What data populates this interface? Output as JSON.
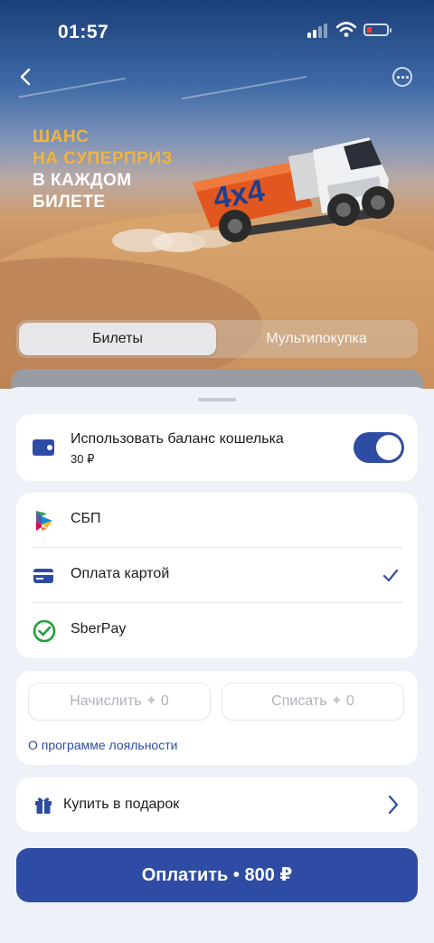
{
  "status_bar": {
    "time": "01:57"
  },
  "promo": {
    "lines": [
      "ШАНС",
      "НА СУПЕРПРИЗ",
      "В КАЖДОМ",
      "БИЛЕТЕ"
    ],
    "badge": "4x4",
    "accent_color": "#f2b43a"
  },
  "tabs": [
    {
      "label": "Билеты",
      "active": true
    },
    {
      "label": "Мультипокупка",
      "active": false
    }
  ],
  "wallet": {
    "label": "Использовать баланс кошелька",
    "amount": "30 ₽",
    "toggle_on": true
  },
  "payment_methods": [
    {
      "label": "СБП",
      "icon": "sbp-icon",
      "selected": false
    },
    {
      "label": "Оплата картой",
      "icon": "card-icon",
      "selected": true
    },
    {
      "label": "SberPay",
      "icon": "sberpay-icon",
      "selected": false
    }
  ],
  "loyalty": {
    "accrue_label": "Начислить",
    "accrue_value": "0",
    "spend_label": "Списать",
    "spend_value": "0",
    "star_glyph": "✦",
    "link": "О программе лояльности"
  },
  "gift": {
    "label": "Купить в подарок"
  },
  "pay_button": {
    "label": "Оплатить • 800 ₽"
  },
  "colors": {
    "primary": "#2e4ca3",
    "sheet_bg": "#eef1f8",
    "sber_green": "#21a038"
  }
}
